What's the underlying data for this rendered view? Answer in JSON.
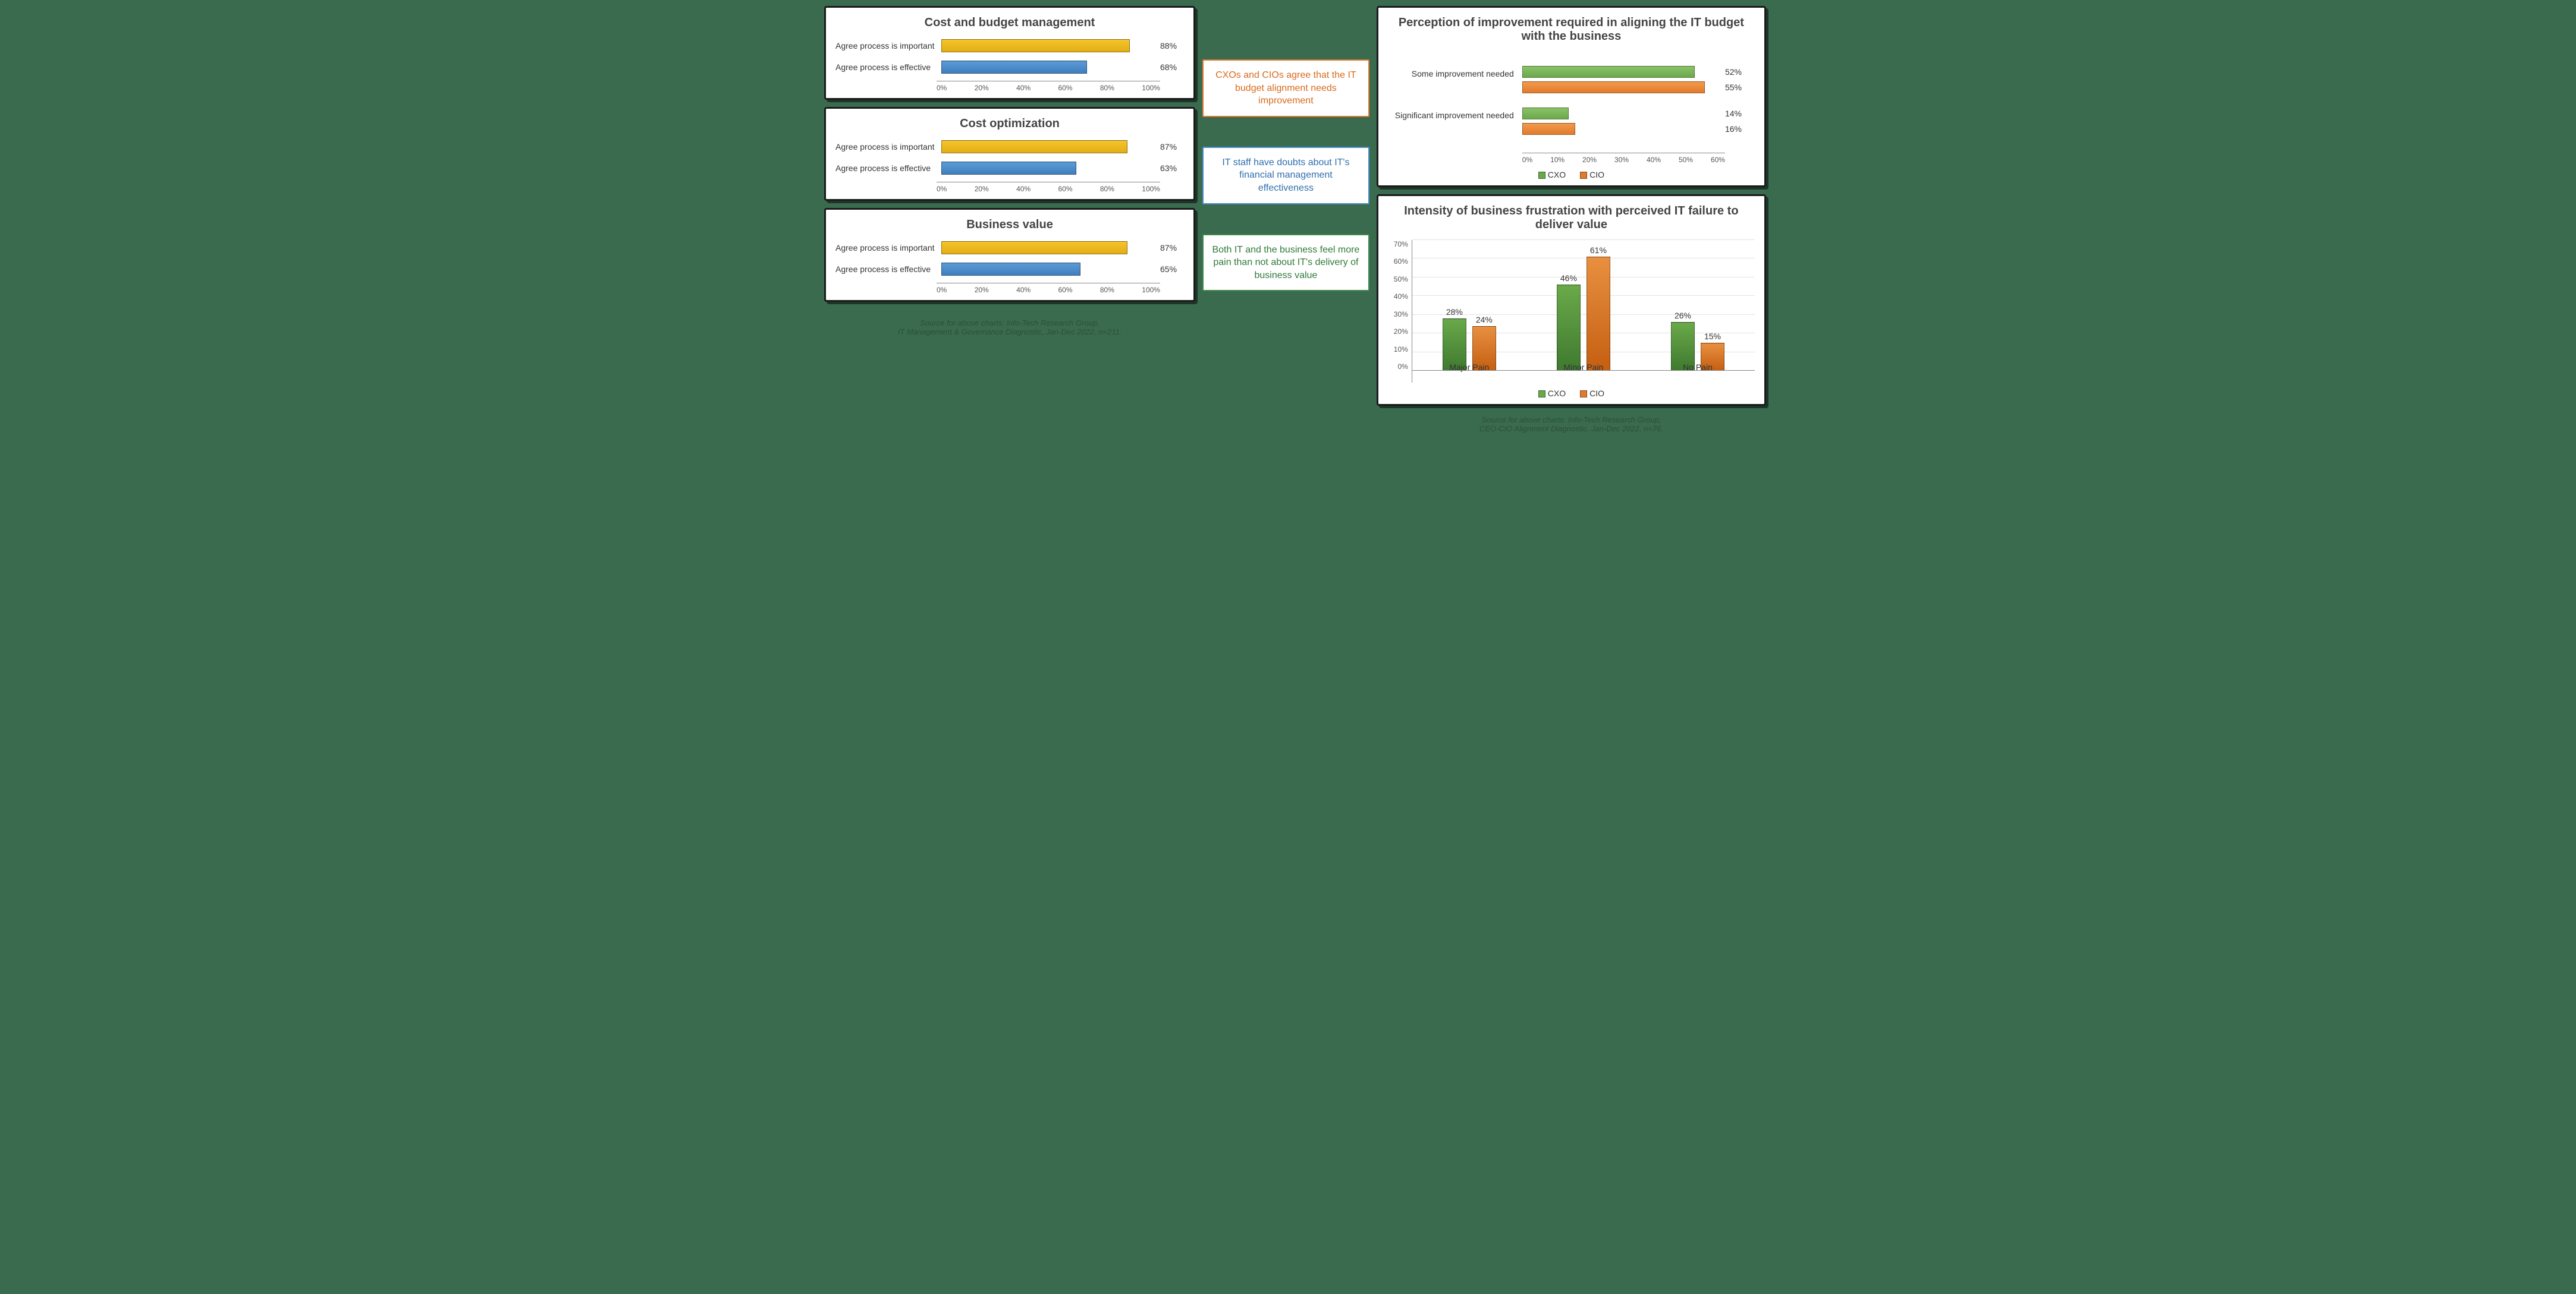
{
  "left": {
    "charts": [
      {
        "title": "Cost and budget management",
        "rows": [
          {
            "label": "Agree process is important",
            "value": 88,
            "display": "88%",
            "color": "yellow"
          },
          {
            "label": "Agree process is effective",
            "value": 68,
            "display": "68%",
            "color": "blue"
          }
        ],
        "axis": [
          "0%",
          "20%",
          "40%",
          "60%",
          "80%",
          "100%"
        ]
      },
      {
        "title": "Cost optimization",
        "rows": [
          {
            "label": "Agree process is important",
            "value": 87,
            "display": "87%",
            "color": "yellow"
          },
          {
            "label": "Agree process is effective",
            "value": 63,
            "display": "63%",
            "color": "blue"
          }
        ],
        "axis": [
          "0%",
          "20%",
          "40%",
          "60%",
          "80%",
          "100%"
        ]
      },
      {
        "title": "Business value",
        "rows": [
          {
            "label": "Agree process is important",
            "value": 87,
            "display": "87%",
            "color": "yellow"
          },
          {
            "label": "Agree process is effective",
            "value": 65,
            "display": "65%",
            "color": "blue"
          }
        ],
        "axis": [
          "0%",
          "20%",
          "40%",
          "60%",
          "80%",
          "100%"
        ]
      }
    ],
    "source_line1": "Source for above charts: Info-Tech Research Group,",
    "source_line2": "IT Management & Governance Diagnostic, Jan-Dec 2022, n=211."
  },
  "mid": {
    "callouts": [
      {
        "text": "CXOs and CIOs agree that the IT budget alignment needs improvement",
        "style": "orange"
      },
      {
        "text": "IT staff have doubts about IT's financial management effectiveness",
        "style": "blue"
      },
      {
        "text": "Both IT and the business feel more pain than not about IT's delivery of business value",
        "style": "green"
      }
    ]
  },
  "right": {
    "chart_top": {
      "title": "Perception of improvement required in aligning the IT budget with the business",
      "max": 60,
      "axis": [
        "0%",
        "10%",
        "20%",
        "30%",
        "40%",
        "50%",
        "60%"
      ],
      "categories": [
        {
          "label": "Some improvement needed",
          "bars": [
            {
              "series": "CXO",
              "value": 52,
              "display": "52%",
              "color": "green"
            },
            {
              "series": "CIO",
              "value": 55,
              "display": "55%",
              "color": "orange"
            }
          ]
        },
        {
          "label": "Significant improvement needed",
          "bars": [
            {
              "series": "CXO",
              "value": 14,
              "display": "14%",
              "color": "green"
            },
            {
              "series": "CIO",
              "value": 16,
              "display": "16%",
              "color": "orange"
            }
          ]
        }
      ],
      "legend": [
        {
          "name": "CXO",
          "color": "green"
        },
        {
          "name": "CIO",
          "color": "orange"
        }
      ]
    },
    "chart_bottom": {
      "title": "Intensity of business frustration with perceived IT failure to deliver value",
      "ymax": 70,
      "yticks": [
        "0%",
        "10%",
        "20%",
        "30%",
        "40%",
        "50%",
        "60%",
        "70%"
      ],
      "groups": [
        {
          "label": "Major Pain",
          "bars": [
            {
              "series": "CXO",
              "value": 28,
              "display": "28%",
              "color": "green"
            },
            {
              "series": "CIO",
              "value": 24,
              "display": "24%",
              "color": "orange"
            }
          ]
        },
        {
          "label": "Minor Pain",
          "bars": [
            {
              "series": "CXO",
              "value": 46,
              "display": "46%",
              "color": "green"
            },
            {
              "series": "CIO",
              "value": 61,
              "display": "61%",
              "color": "orange"
            }
          ]
        },
        {
          "label": "No Pain",
          "bars": [
            {
              "series": "CXO",
              "value": 26,
              "display": "26%",
              "color": "green"
            },
            {
              "series": "CIO",
              "value": 15,
              "display": "15%",
              "color": "orange"
            }
          ]
        }
      ],
      "legend": [
        {
          "name": "CXO",
          "color": "green"
        },
        {
          "name": "CIO",
          "color": "orange"
        }
      ]
    },
    "source_line1": "Source for above charts: Info-Tech Research Group,",
    "source_line2": "CEO-CIO Alignment Diagnostic, Jan-Dec 2022, n=76."
  },
  "chart_data": [
    {
      "type": "bar",
      "orientation": "horizontal",
      "title": "Cost and budget management",
      "categories": [
        "Agree process is important",
        "Agree process is effective"
      ],
      "values": [
        88,
        68
      ],
      "xlim": [
        0,
        100
      ],
      "xlabel": "%"
    },
    {
      "type": "bar",
      "orientation": "horizontal",
      "title": "Cost optimization",
      "categories": [
        "Agree process is important",
        "Agree process is effective"
      ],
      "values": [
        87,
        63
      ],
      "xlim": [
        0,
        100
      ],
      "xlabel": "%"
    },
    {
      "type": "bar",
      "orientation": "horizontal",
      "title": "Business value",
      "categories": [
        "Agree process is important",
        "Agree process is effective"
      ],
      "values": [
        87,
        65
      ],
      "xlim": [
        0,
        100
      ],
      "xlabel": "%"
    },
    {
      "type": "bar",
      "orientation": "horizontal",
      "title": "Perception of improvement required in aligning the IT budget with the business",
      "categories": [
        "Some improvement needed",
        "Significant improvement needed"
      ],
      "series": [
        {
          "name": "CXO",
          "values": [
            52,
            14
          ]
        },
        {
          "name": "CIO",
          "values": [
            55,
            16
          ]
        }
      ],
      "xlim": [
        0,
        60
      ],
      "xlabel": "%",
      "legend_position": "bottom"
    },
    {
      "type": "bar",
      "orientation": "vertical",
      "title": "Intensity of business frustration with perceived IT failure to deliver value",
      "categories": [
        "Major Pain",
        "Minor Pain",
        "No Pain"
      ],
      "series": [
        {
          "name": "CXO",
          "values": [
            28,
            46,
            26
          ]
        },
        {
          "name": "CIO",
          "values": [
            24,
            61,
            15
          ]
        }
      ],
      "ylim": [
        0,
        70
      ],
      "ylabel": "%",
      "legend_position": "bottom"
    }
  ]
}
